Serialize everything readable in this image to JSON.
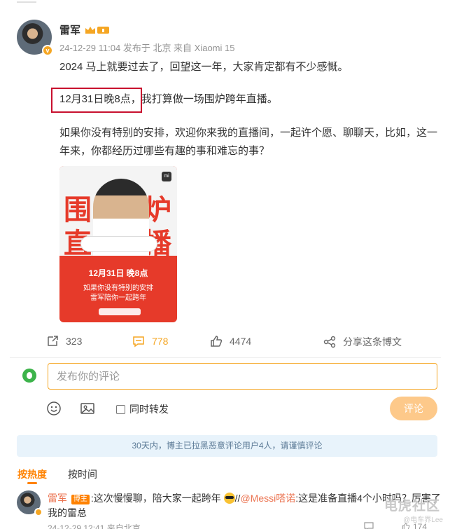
{
  "post": {
    "author": "雷军",
    "meta": "24-12-29 11:04  发布于 北京  来自 Xiaomi 15",
    "para1": "2024 马上就要过去了，回望这一年，大家肯定都有不少感慨。",
    "para2_highlight": "12月31日晚8点，",
    "para2_rest": "我打算做一场围炉跨年直播。",
    "para3": "如果你没有特别的安排，欢迎你来我的直播间，一起许个愿、聊聊天，比如，这一年来，你都经历过哪些有趣的事和难忘的事？",
    "poster": {
      "logo": "mi",
      "char1": "围",
      "char2": "炉",
      "char3": "直",
      "char4": "播",
      "date": "12月31日 晚8点",
      "line1": "如果你没有特别的安排",
      "line2": "雷军陪你一起跨年"
    },
    "actions": {
      "reposts": "323",
      "comments": "778",
      "likes": "4474",
      "share_label": "分享这条博文"
    }
  },
  "composer": {
    "placeholder": "发布你的评论",
    "forward_label": "同时转发",
    "submit_label": "评论"
  },
  "notice": "30天内，博主已拉黑恶意评论用户4人，请谨慎评论",
  "tabs": {
    "hot": "按热度",
    "time": "按时间"
  },
  "comment": {
    "name": "雷军",
    "tag": "博主",
    "text1": ":这次慢慢聊，陪大家一起跨年",
    "sep": "//",
    "at": "@Messi嗒诺",
    "text2": ":这是准备直播4个小时吗？厉害了我的雷总",
    "meta": "24-12-29 12:41  来自北京",
    "like_count": "174"
  },
  "watermark": {
    "main": "电虎社区",
    "sub": "@电车界Lee"
  },
  "colors": {
    "accent": "#ff8200",
    "comment_orange": "#f5a623",
    "highlight_box": "#c8102e",
    "notice_bg": "#e8f3fb"
  }
}
